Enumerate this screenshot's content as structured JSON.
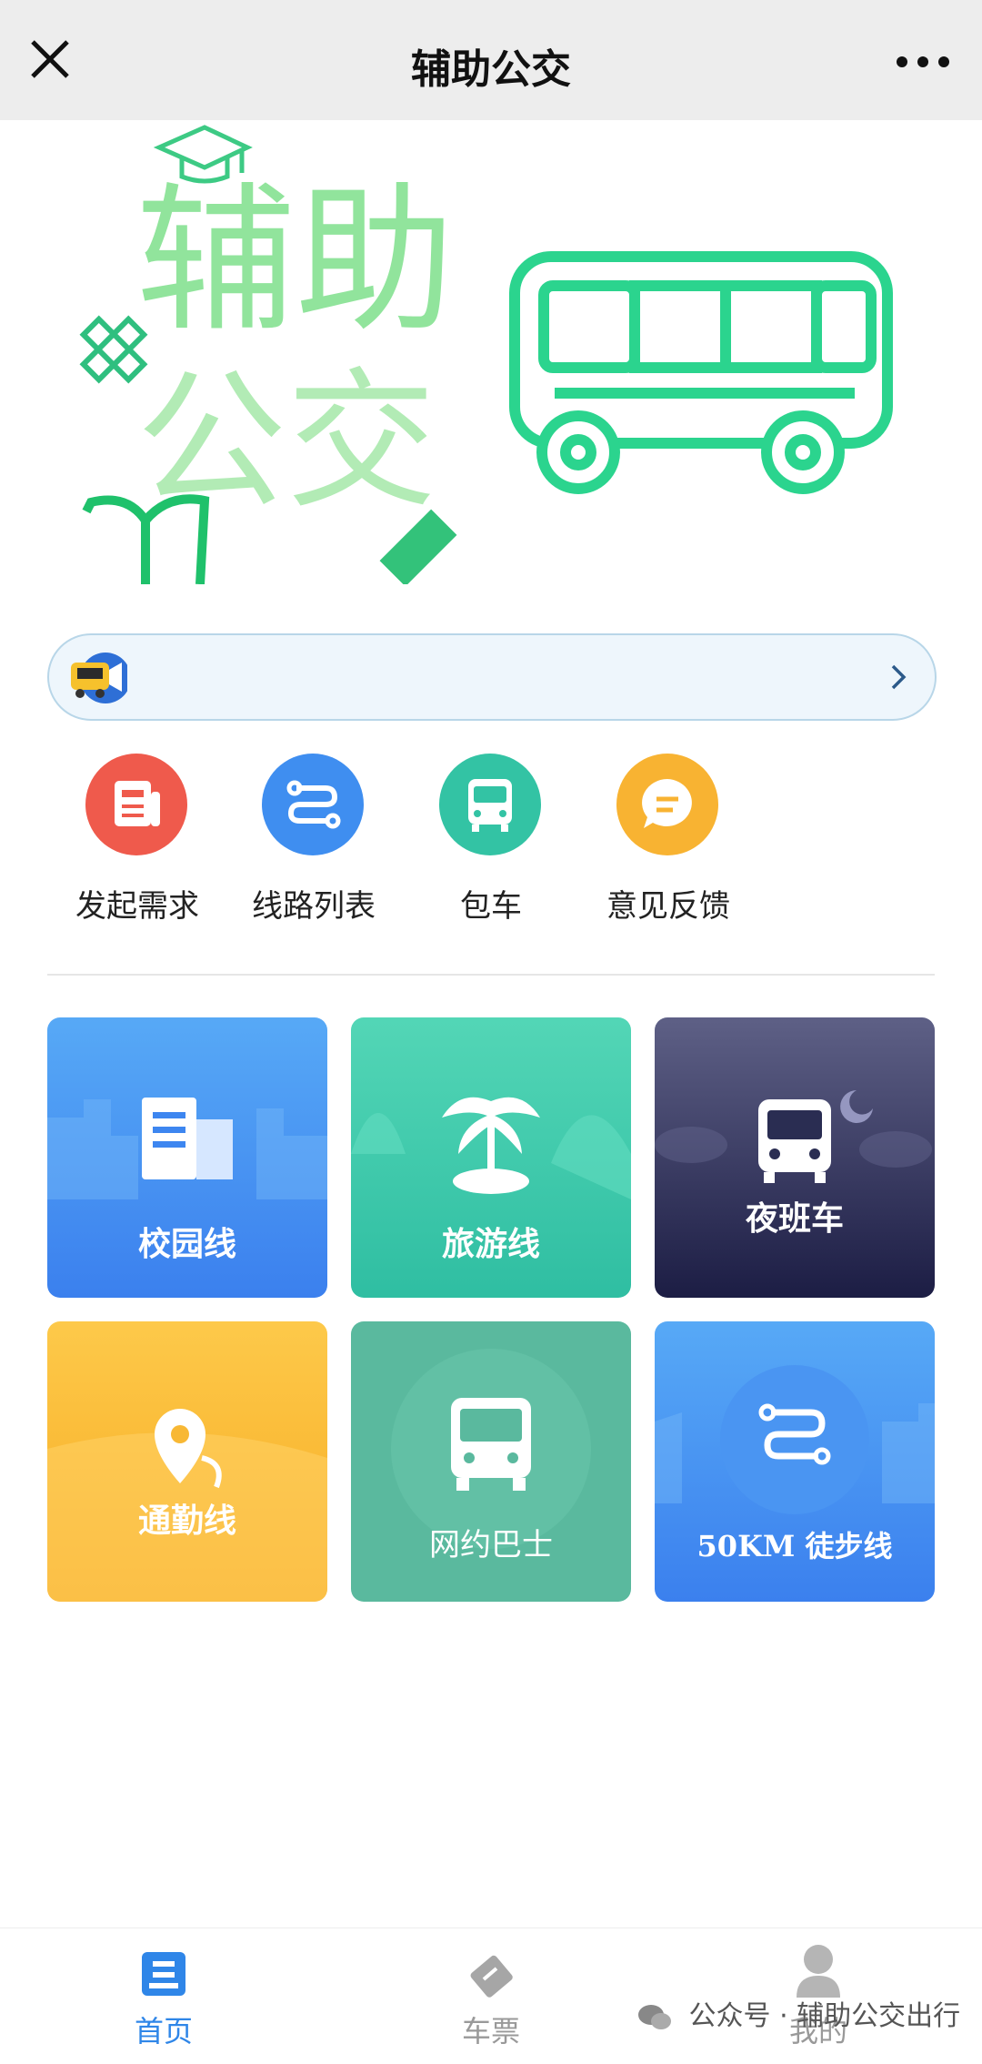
{
  "header": {
    "title": "辅助公交",
    "close_icon": "close-icon",
    "more_icon": "more-dots-icon"
  },
  "banner": {
    "text_line1": "辅助",
    "text_line2": "公交",
    "icon": "bus-icon"
  },
  "notice": {
    "text": "",
    "icon": "mascot-megaphone-icon",
    "arrow": "chevron-right-icon"
  },
  "quick_actions": [
    {
      "label": "发起需求",
      "icon": "document-icon",
      "color": "#ef5a4c"
    },
    {
      "label": "线路列表",
      "icon": "route-icon",
      "color": "#3f8ef0"
    },
    {
      "label": "包车",
      "icon": "bus-icon",
      "color": "#33c3a4"
    },
    {
      "label": "意见反馈",
      "icon": "chat-bubble-icon",
      "color": "#f8b332"
    }
  ],
  "tiles": [
    {
      "label": "校园线",
      "icon": "building-icon",
      "color": "#3d86f0"
    },
    {
      "label": "旅游线",
      "icon": "palm-tree-icon",
      "color": "#3ccaa8"
    },
    {
      "label": "夜班车",
      "icon": "bus-icon",
      "color": "#2a2d52"
    },
    {
      "label": "通勤线",
      "icon": "location-pin-icon",
      "color": "#f8b834"
    },
    {
      "label": "网约巴士",
      "icon": "bus-icon",
      "color": "#5ab99e"
    },
    {
      "label": "50KM 徒步线",
      "icon": "route-icon",
      "color": "#3f8ef0"
    }
  ],
  "bottom_nav": [
    {
      "label": "首页",
      "icon": "home-icon",
      "active": true
    },
    {
      "label": "车票",
      "icon": "ticket-icon",
      "active": false
    },
    {
      "label": "我的",
      "icon": "user-icon",
      "active": false
    }
  ],
  "watermark": "公众号 · 辅助公交出行",
  "colors": {
    "active": "#2f86e8",
    "inactive": "#999999"
  }
}
